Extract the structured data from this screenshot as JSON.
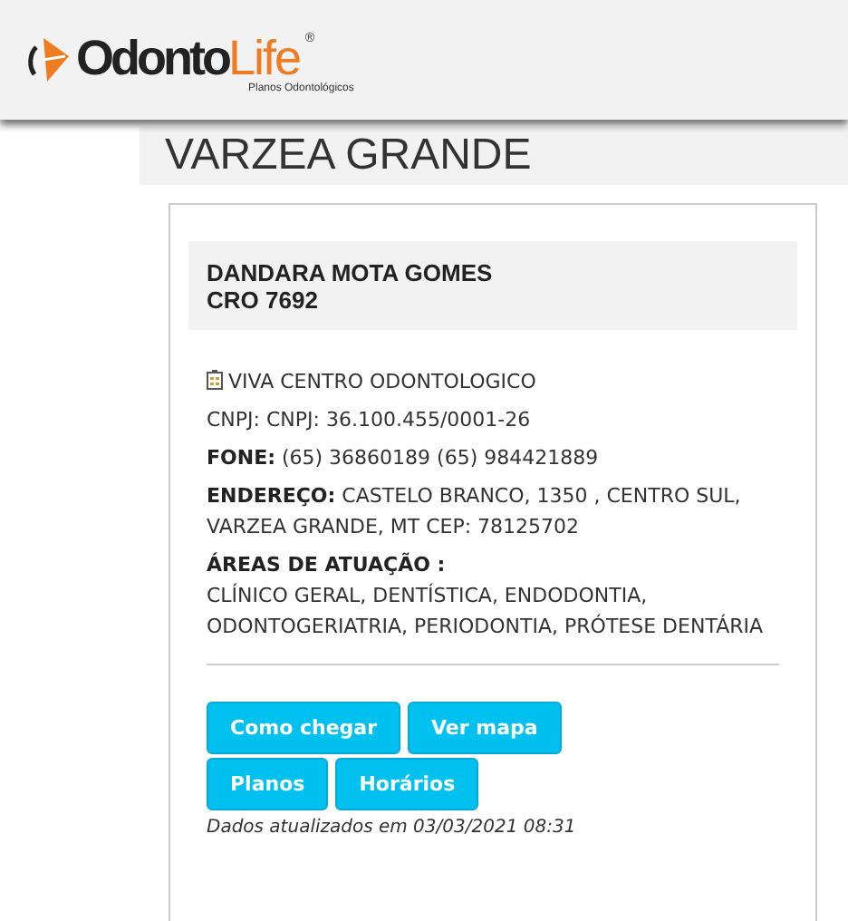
{
  "header": {
    "logo": {
      "word_dark": "Odonto",
      "word_accent": "Life",
      "mark": "®",
      "tagline": "Planos Odontológicos"
    }
  },
  "page_title": "VARZEA GRANDE",
  "card": {
    "name": "DANDARA MOTA GOMES",
    "registration": "CRO 7692",
    "info": [
      {
        "kind": "clinic",
        "text": "VIVA CENTRO ODONTOLOGICO"
      },
      {
        "kind": "line",
        "text": "CNPJ: CNPJ: 36.100.455/0001-26"
      },
      {
        "kind": "line",
        "text": "**FONE:** (65) 36860189 (65) 984421889"
      },
      {
        "kind": "line",
        "text": "**ENDEREÇO:** CASTELO BRANCO, 1350 , CENTRO SUL, VARZEA GRANDE, MT CEP: 78125702"
      },
      {
        "kind": "heading",
        "text": "ÁREAS DE ATUAÇÃO :"
      },
      {
        "kind": "list",
        "text": "CLÍNICO GERAL, DENTÍSTICA, ENDODONTIA, ODONTOGERIATRIA, PERIODONTIA, PRÓTESE DENTÁRIA"
      }
    ],
    "buttons": [
      "Como chegar",
      "Ver mapa",
      "Planos",
      "Horários"
    ],
    "updated": "Dados atualizados em 03/03/2021 08:31"
  }
}
